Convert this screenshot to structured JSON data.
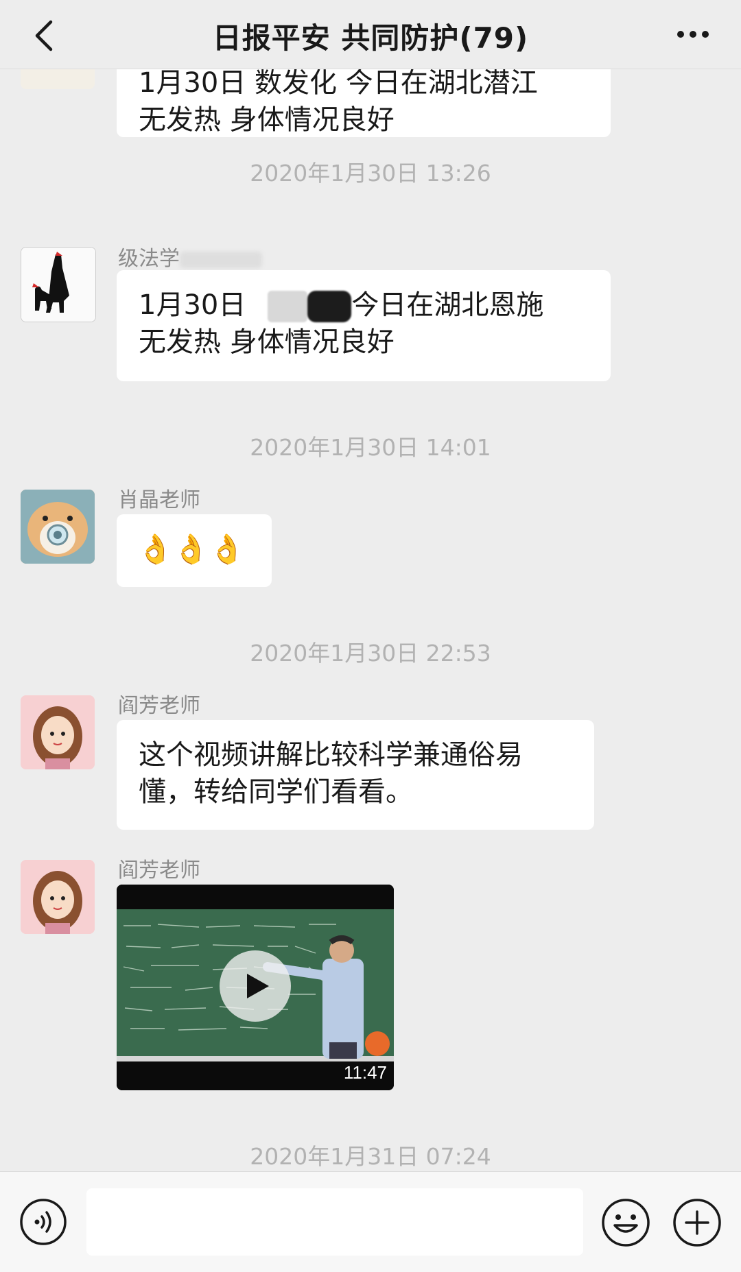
{
  "header": {
    "title": "日报平安 共同防护(79)",
    "back_icon": "chevron-left-icon",
    "more_icon": "more-dots-icon"
  },
  "messages": {
    "top_partial": {
      "line1": "1月30日 数发化 今日在湖北潜江",
      "line2": "无发热 身体情况良好"
    },
    "time1": "2020年1月30日 13:26",
    "msg1": {
      "sender": "级法学",
      "prefix": "1月30日",
      "line1_rest": "今日在湖北恩施",
      "line2": "无发热 身体情况良好"
    },
    "time2": "2020年1月30日 14:01",
    "msg2": {
      "sender": "肖晶老师",
      "emoji": "👌👌👌"
    },
    "time3": "2020年1月30日 22:53",
    "msg3": {
      "sender": "阎芳老师",
      "line1": "这个视频讲解比较科学兼通俗易",
      "line2": "懂，转给同学们看看。"
    },
    "msg4": {
      "sender": "阎芳老师",
      "video_duration": "11:47"
    },
    "time4": "2020年1月31日 07:24"
  },
  "inputbar": {
    "voice_icon": "voice-icon",
    "emoji_icon": "emoji-icon",
    "plus_icon": "plus-icon",
    "input_value": ""
  }
}
